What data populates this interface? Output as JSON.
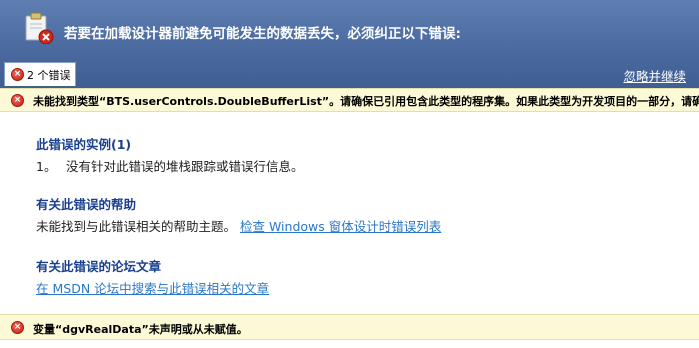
{
  "header": {
    "title": "若要在加载设计器前避免可能发生的数据丢失，必须纠正以下错误:",
    "icon": "clipboard-error-icon"
  },
  "tab": {
    "label": "2 个错误"
  },
  "ignore_link": "忽略并继续",
  "errors": [
    {
      "text": "未能找到类型“BTS.userControls.DoubleBufferList”。请确保已引用包含此类型的程序集。如果此类型为开发项目的一部分，请确保已使用针对您的当前平台或任意CPU的设置成功生成了该项目。"
    },
    {
      "text": "变量“dgvRealData”未声明或从未赋值。"
    }
  ],
  "details": {
    "instances_title": "此错误的实例(1)",
    "instance_number": "1。",
    "instance_text": "没有针对此错误的堆栈跟踪或错误行信息。",
    "help_title": "有关此错误的帮助",
    "help_text": "未能找到与此错误相关的帮助主题。",
    "help_link": "检查 Windows 窗体设计时错误列表",
    "forum_title": "有关此错误的论坛文章",
    "forum_link": "在 MSDN 论坛中搜索与此错误相关的文章"
  },
  "colors": {
    "header": "#4a6aa0",
    "error_bar": "#fcfad6",
    "section_title": "#1a3f8f",
    "link": "#2a77c9"
  }
}
